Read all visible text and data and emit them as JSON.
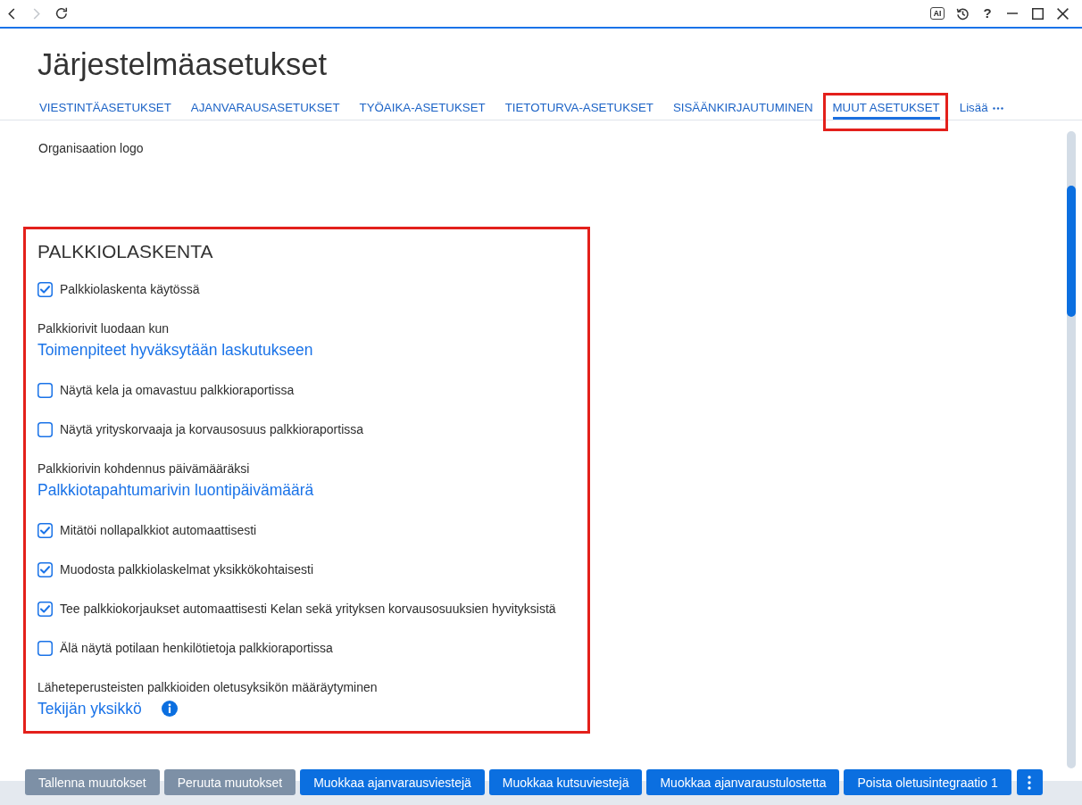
{
  "browser_bar": {
    "nav_buttons": [
      {
        "kind": "back",
        "disabled": false
      },
      {
        "kind": "forward",
        "disabled": true
      },
      {
        "kind": "reload",
        "disabled": false
      }
    ],
    "tools": [
      {
        "kind": "ai",
        "label": "AI"
      },
      {
        "kind": "history"
      },
      {
        "kind": "help",
        "label": "?"
      },
      {
        "kind": "minimize"
      },
      {
        "kind": "maximize"
      },
      {
        "kind": "close"
      }
    ]
  },
  "page_title": "Järjestelmäasetukset",
  "tabs": [
    {
      "label": "VIESTINTÄASETUKSET",
      "selected": false,
      "highlighted": false
    },
    {
      "label": "AJANVARAUSASETUKSET",
      "selected": false,
      "highlighted": false
    },
    {
      "label": "TYÖAIKA-ASETUKSET",
      "selected": false,
      "highlighted": false
    },
    {
      "label": "TIETOTURVA-ASETUKSET",
      "selected": false,
      "highlighted": false
    },
    {
      "label": "SISÄÄNKIRJAUTUMINEN",
      "selected": false,
      "highlighted": false
    },
    {
      "label": "MUUT ASETUKSET",
      "selected": true,
      "highlighted": true
    }
  ],
  "more_tab": {
    "label": "Lisää"
  },
  "organisation_logo": {
    "label": "Organisaation logo"
  },
  "section": {
    "title": "PALKKIOLASKENTA",
    "highlighted": true,
    "items": [
      {
        "kind": "checkbox",
        "label": "Palkkiolaskenta käytössä",
        "checked": true
      },
      {
        "kind": "select",
        "label": "Palkkiorivit luodaan kun",
        "value": "Toimenpiteet hyväksytään laskutukseen",
        "info": false
      },
      {
        "kind": "checkbox",
        "label": "Näytä kela ja omavastuu palkkioraportissa",
        "checked": false
      },
      {
        "kind": "checkbox",
        "label": "Näytä yrityskorvaaja ja korvausosuus palkkioraportissa",
        "checked": false
      },
      {
        "kind": "select",
        "label": "Palkkiorivin kohdennus päivämääräksi",
        "value": "Palkkiotapahtumarivin luontipäivämäärä",
        "info": false
      },
      {
        "kind": "checkbox",
        "label": "Mitätöi nollapalkkiot automaattisesti",
        "checked": true
      },
      {
        "kind": "checkbox",
        "label": "Muodosta palkkiolaskelmat yksikkökohtaisesti",
        "checked": true
      },
      {
        "kind": "checkbox",
        "label": "Tee palkkiokorjaukset automaattisesti Kelan sekä yrityksen korvausosuuksien hyvityksistä",
        "checked": true
      },
      {
        "kind": "checkbox",
        "label": "Älä näytä potilaan henkilötietoja palkkioraportissa",
        "checked": false
      },
      {
        "kind": "select",
        "label": "Läheteperusteisten palkkioiden oletusyksikön määräytyminen",
        "value": "Tekijän yksikkö",
        "info": true
      }
    ]
  },
  "footer": {
    "buttons": [
      {
        "label": "Tallenna muutokset",
        "disabled": true
      },
      {
        "label": "Peruuta muutokset",
        "disabled": true
      },
      {
        "label": "Muokkaa ajanvarausviestejä",
        "disabled": false
      },
      {
        "label": "Muokkaa kutsuviestejä",
        "disabled": false
      },
      {
        "label": "Muokkaa ajanvaraustulostetta",
        "disabled": false
      },
      {
        "label": "Poista oletusintegraatio 1",
        "disabled": false
      }
    ]
  }
}
